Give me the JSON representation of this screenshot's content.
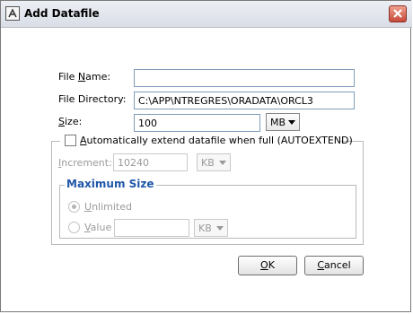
{
  "window": {
    "title": "Add Datafile",
    "icon": "app-icon",
    "close_icon": "close-icon"
  },
  "fields": {
    "file_name": {
      "label_u": "File ",
      "label_key": "N",
      "label_rest": "ame:",
      "value": ""
    },
    "file_directory": {
      "label": "File Directory:",
      "value": "C:\\APP\\NTREGRES\\ORADATA\\ORCL3"
    },
    "size": {
      "label_key": "S",
      "label_rest": "ize:",
      "value": "100",
      "unit": "MB"
    }
  },
  "autoextend": {
    "label_key": "A",
    "label_rest": "utomatically extend datafile when full (AUTOEXTEND)",
    "checked": false,
    "increment": {
      "label_key": "I",
      "label_rest": "ncrement:",
      "value": "10240",
      "unit": "KB"
    },
    "max_size": {
      "title": "Maximum Size",
      "unlimited": {
        "label_key": "U",
        "label_rest": "nlimited",
        "selected": true
      },
      "value_option": {
        "label_key": "V",
        "label_rest": "alue",
        "value": "",
        "unit": "KB"
      }
    }
  },
  "buttons": {
    "ok_key": "O",
    "ok_rest": "K",
    "cancel_key": "C",
    "cancel_rest": "ancel"
  },
  "colors": {
    "group_title": "#1f56a8",
    "disabled_text": "#9a9a9a"
  }
}
